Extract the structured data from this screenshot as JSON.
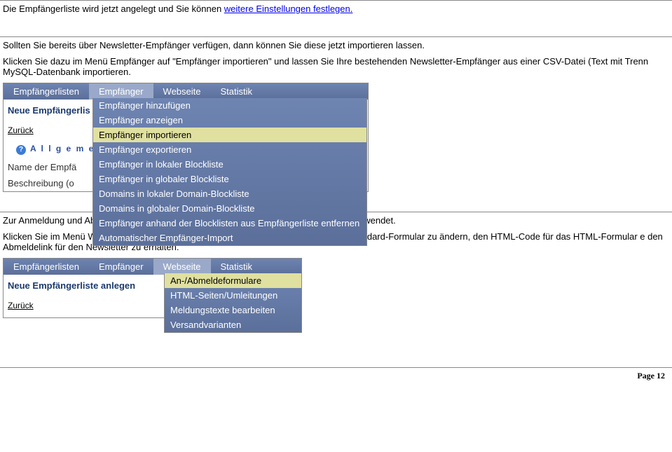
{
  "intro": {
    "line1_pre": "Die Empfängerliste wird jetzt angelegt und Sie können ",
    "line1_link": "weitere Einstellungen festlegen.",
    "line2": "Sollten Sie bereits über Newsletter-Empfänger verfügen, dann können Sie diese jetzt importieren lassen.",
    "line3": "Klicken Sie dazu im Menü Empfänger auf \"Empfänger importieren\" und lassen Sie Ihre bestehenden Newsletter-Empfänger aus einer CSV-Datei (Text mit Trenn MySQL-Datenbank importieren."
  },
  "card1": {
    "menu": {
      "tab1": "Empfängerlisten",
      "tab2": "Empfänger",
      "tab3": "Webseite",
      "tab4": "Statistik"
    },
    "dropdown": [
      "Empfänger hinzufügen",
      "Empfänger anzeigen",
      "Empfänger importieren",
      "Empfänger exportieren",
      "Empfänger in lokaler Blockliste",
      "Empfänger in globaler Blockliste",
      "Domains in lokaler Domain-Blockliste",
      "Domains in globaler Domain-Blockliste",
      "Empfänger anhand der Blocklisten aus Empfängerliste entfernen",
      "Automatischer Empfänger-Import"
    ],
    "highlight_index": 2,
    "heading": "Neue Empfängerlis",
    "back": "Zurück",
    "section": "A l l g e m e i n",
    "field1": "Name der Empfä",
    "field2": "Beschreibung (o"
  },
  "mid": {
    "line1": "Zur Anmeldung und Abmeldung von der Empfängerliste wird ein An-/Abmeldeformular verwendet.",
    "line2": "Klicken Sie im Menü Webseite auf \"An-/Abmeldeformulare\", um das derzeit definierte Standard-Formular zu ändern, den HTML-Code für das HTML-Formular e den Abmeldelink für den Newsletter zu erhalten."
  },
  "card2": {
    "menu": {
      "tab1": "Empfängerlisten",
      "tab2": "Empfänger",
      "tab3": "Webseite",
      "tab4": "Statistik"
    },
    "dropdown": [
      "An-/Abmeldeformulare",
      "HTML-Seiten/Umleitungen",
      "Meldungstexte bearbeiten",
      "Versandvarianten"
    ],
    "highlight_index": 0,
    "heading": "Neue Empfängerliste anlegen",
    "back": "Zurück"
  },
  "page_num": "Page 12"
}
